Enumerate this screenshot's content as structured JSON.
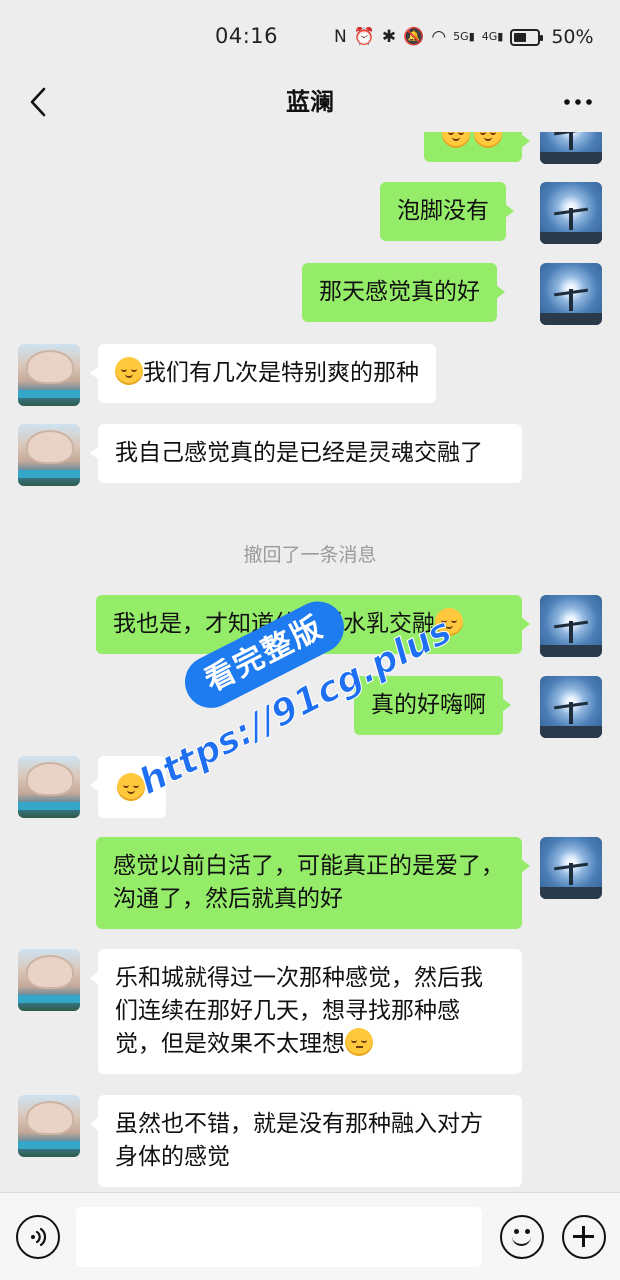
{
  "status_bar": {
    "time": "04:16",
    "battery": "50%",
    "signal_labels": [
      "5G",
      "4G"
    ]
  },
  "header": {
    "title": "蓝澜"
  },
  "messages": [
    {
      "from": "me",
      "text": "泡脚没有"
    },
    {
      "from": "me",
      "text": "那天感觉真的好"
    },
    {
      "from": "her",
      "text": "我们有几次是特别爽的那种",
      "emoji_before": "blush-emoji"
    },
    {
      "from": "her",
      "text": "我自己感觉真的是已经是灵魂交融了"
    },
    {
      "from": "me",
      "text": "我也是，才知道什么叫水乳交融",
      "emoji_after": "blush-emoji"
    },
    {
      "from": "me",
      "text": "真的好嗨啊"
    },
    {
      "from": "her",
      "text": "",
      "emoji_only": "blush-emoji"
    },
    {
      "from": "me",
      "text": "感觉以前白活了，可能真正的是爱了，沟通了，然后就真的好"
    },
    {
      "from": "her",
      "text": "乐和城就得过一次那种感觉，然后我们连续在那好几天，想寻找那种感觉，但是效果不太理想",
      "emoji_after": "thinking-emoji"
    },
    {
      "from": "her",
      "text": "虽然也不错，就是没有那种融入对方身体的感觉"
    }
  ],
  "system_note": "撤回了一条消息",
  "watermark": {
    "badge": "看完整版",
    "url": "https://91cg.plus"
  },
  "input_bar": {
    "placeholder": ""
  },
  "colors": {
    "background": "#ededed",
    "my_bubble": "#95ec69",
    "her_bubble": "#ffffff",
    "watermark_blue": "#1f7bf0"
  }
}
